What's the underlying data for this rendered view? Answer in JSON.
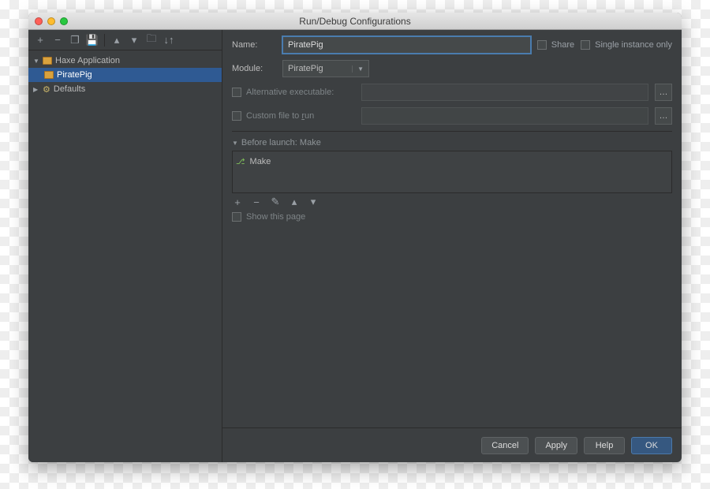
{
  "window_title": "Run/Debug Configurations",
  "sidebar": {
    "tree": {
      "root": {
        "label": "Haxe Application"
      },
      "child": {
        "label": "PiratePig"
      },
      "defaults": {
        "label": "Defaults"
      }
    }
  },
  "form": {
    "name_label": "Name:",
    "name_value": "PiratePig",
    "share_label": "Share",
    "single_instance_label": "Single instance only",
    "module_label": "Module:",
    "module_value": "PiratePig",
    "alt_exec_label": "Alternative executable:",
    "custom_file_label_pre": "Custom file to ",
    "custom_file_label_key": "r",
    "custom_file_label_post": "un",
    "before_launch_label": "Before launch: Make",
    "make_item": "Make",
    "show_page_label": "Show this page"
  },
  "buttons": {
    "cancel": "Cancel",
    "apply": "Apply",
    "help": "Help",
    "ok": "OK"
  }
}
